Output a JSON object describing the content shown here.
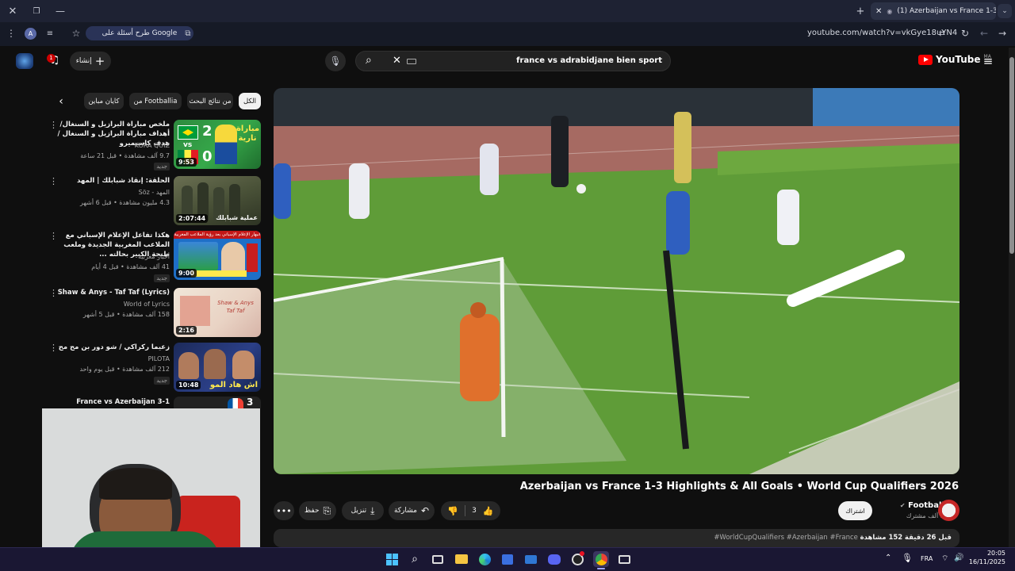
{
  "browser": {
    "tab_title": "(1) Azerbaijan vs France 1-3",
    "omnibox_chip": "طرح أسئلة على Google",
    "url": "youtube.com/watch?v=vkGye18uYN4",
    "accent": "#2a3357"
  },
  "youtube": {
    "notifications_count": "1",
    "create_label": "إنشاء",
    "search_query": "france vs adrabidjane bien sport",
    "logo_text": "YouTube",
    "region": "MA",
    "chips": [
      "الكل",
      "من نتائج البحث",
      "من Footballia",
      "كايان مباين"
    ]
  },
  "recommendations": [
    {
      "title": "ملخص مباراة البرازيل و السنغال/أهداف مباراة البرازيل و السنغال / هدف كاسيميرو",
      "channel": "KORA QUIZ",
      "meta": "9.7 آلف مشاهدة • قبل 21 ساعة",
      "badge": "جديد",
      "duration": "9:53",
      "score_a": "2",
      "score_b": "0",
      "thumb_text": "مباراة نارية"
    },
    {
      "title": "الحلقة: إنقاذ شبابلك | المهد",
      "channel": "المهد - Söz",
      "meta": "4.3 مليون مشاهدة • قبل 6 أشهر",
      "badge": "",
      "duration": "2:07:44",
      "thumb_text": "عملية شبابلك"
    },
    {
      "title": "هكذا تفاعل الإعلام الإسباني مع الملاعب المغربية الجديدة وملعب طنجة الكبير بحالته ...",
      "channel": "أخبار مغربية",
      "meta": "41 آلف مشاهدة • قبل 4 أيام",
      "badge": "جديد",
      "duration": "9:00",
      "thumb_text": "انبهار الإعلام الإسباني بعد رؤية الملاعب المغربية"
    },
    {
      "title": "Shaw & Anys - Taf Taf (Lyrics)",
      "channel": "World of Lyrics",
      "meta": "158 آلف مشاهدة • قبل 5 أشهر",
      "badge": "",
      "duration": "2:16",
      "thumb_text": "Shaw & Anys Taf Taf"
    },
    {
      "title": "زعيما ركراكي / شو دور بن مح مح",
      "channel": "PILOTA",
      "meta": "212 آلف مشاهدة • قبل يوم واحد",
      "badge": "جديد",
      "duration": "10:48",
      "thumb_text": "اش هاد المو"
    },
    {
      "title": "France vs Azerbaijan 3-1",
      "channel": "",
      "meta": "",
      "badge": "",
      "duration": "",
      "thumb_text": "3"
    }
  ],
  "video": {
    "title": "Azerbaijan vs France 1-3 Highlights & All Goals • World Cup Qualifiers 2026",
    "channel": "Footballia",
    "subscribers": "251 آلف مشترك",
    "subscribe_label": "اشتراك",
    "likes": "3",
    "share_label": "مشاركة",
    "download_label": "تنزيل",
    "save_label": "حفظ",
    "views": "152 مشاهدة",
    "age": "قبل 26 دقيقة",
    "tags": "#WorldCupQualifiers #Azerbaijan #France"
  },
  "taskbar": {
    "lang": "FRA",
    "time": "20:05",
    "date": "16/11/2025"
  }
}
